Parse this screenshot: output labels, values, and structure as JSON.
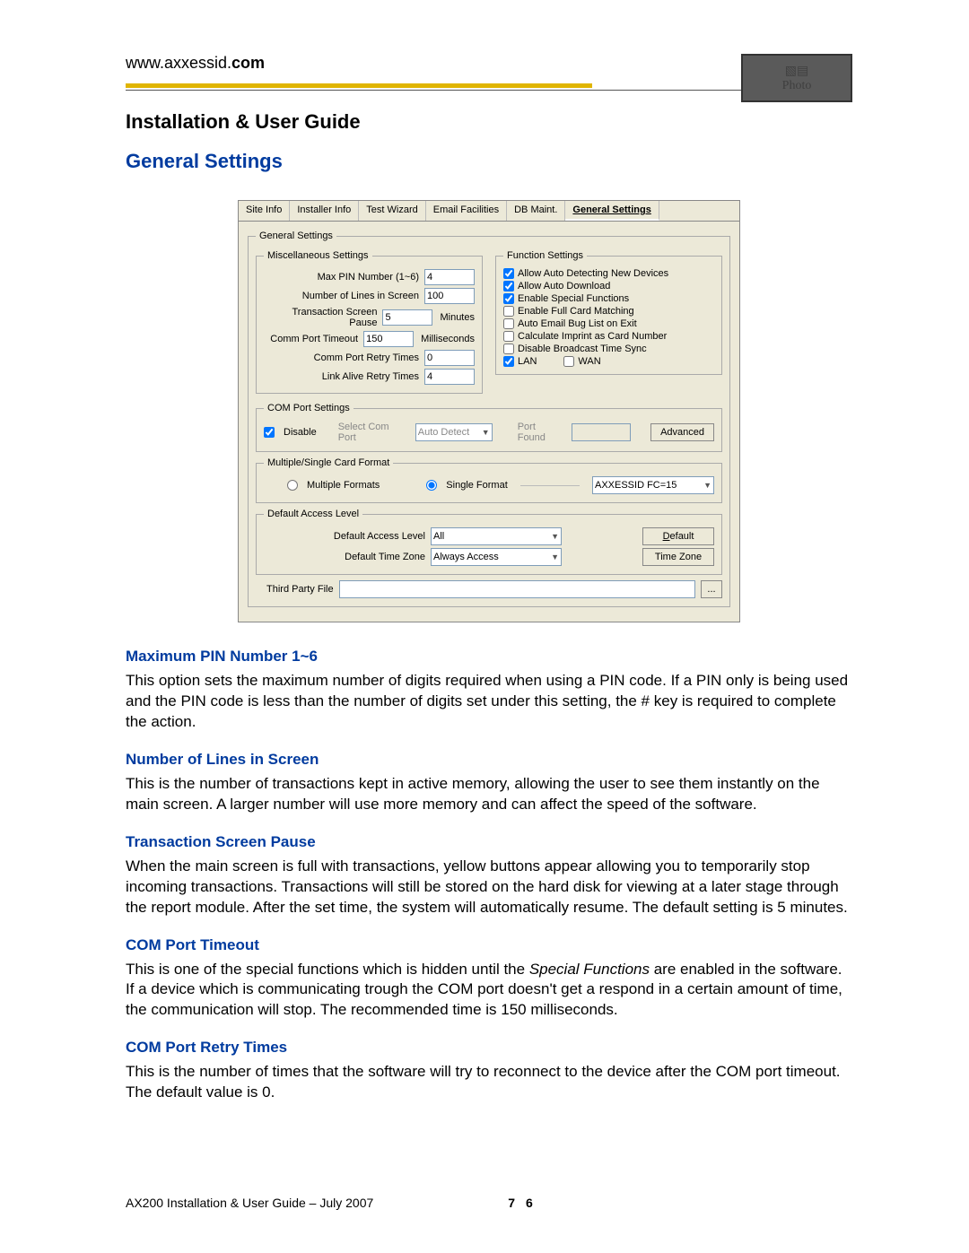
{
  "header": {
    "url_prefix": "www.axxessid.",
    "url_bold": "com",
    "logo_text": "Photo"
  },
  "doc": {
    "title": "Installation & User Guide",
    "section": "General Settings"
  },
  "dialog": {
    "tabs": [
      "Site Info",
      "Installer Info",
      "Test Wizard",
      "Email Facilities",
      "DB Maint.",
      "General Settings"
    ],
    "selected_tab": "General Settings",
    "gs_legend": "General Settings",
    "misc_legend": "Miscellaneous Settings",
    "misc": {
      "max_pin_label": "Max PIN Number (1~6)",
      "max_pin_value": "4",
      "lines_label": "Number of Lines in Screen",
      "lines_value": "100",
      "pause_label": "Transaction Screen Pause",
      "pause_value": "5",
      "pause_unit": "Minutes",
      "timeout_label": "Comm Port Timeout",
      "timeout_value": "150",
      "timeout_unit": "Milliseconds",
      "retry_label": "Comm Port Retry Times",
      "retry_value": "0",
      "alive_label": "Link Alive Retry Times",
      "alive_value": "4"
    },
    "func_legend": "Function Settings",
    "func": {
      "auto_detect": "Allow Auto Detecting New Devices",
      "auto_download": "Allow Auto Download",
      "special": "Enable Special Functions",
      "full_card": "Enable Full Card Matching",
      "auto_email": "Auto Email Bug List on Exit",
      "imprint": "Calculate Imprint as Card Number",
      "broadcast": "Disable Broadcast Time Sync",
      "lan": "LAN",
      "wan": "WAN"
    },
    "com_legend": "COM Port Settings",
    "com": {
      "disable": "Disable",
      "select_label": "Select Com Port",
      "select_value": "Auto Detect",
      "port_found_label": "Port Found",
      "advanced_btn": "Advanced"
    },
    "format_legend": "Multiple/Single Card Format",
    "format": {
      "multiple": "Multiple Formats",
      "single": "Single Format",
      "dropdown": "AXXESSID FC=15"
    },
    "access_legend": "Default Access Level",
    "access": {
      "level_label": "Default Access Level",
      "level_value": "All",
      "default_btn": "Default",
      "tz_label": "Default Time Zone",
      "tz_value": "Always Access",
      "tz_btn": "Time Zone"
    },
    "third_party_label": "Third Party File",
    "ellipsis": "..."
  },
  "sections": [
    {
      "title": "Maximum PIN Number 1~6",
      "body": "This option sets the maximum number of digits required when using a PIN code.  If a PIN only is being used and the PIN code is less than the number of digits set under this setting, the # key is required to complete the action."
    },
    {
      "title": "Number of Lines in Screen",
      "body": "This is the number of transactions kept in active memory, allowing the user to see them instantly on the main screen.  A larger number will use more memory and can affect the speed of the software."
    },
    {
      "title": "Transaction Screen Pause",
      "body": "When the main screen is full with transactions, yellow buttons appear allowing you to temporarily stop incoming transactions.  Transactions will still be stored on the hard disk for viewing at a later stage through the report module.  After the set time, the system will automatically resume.  The default setting is 5 minutes."
    },
    {
      "title": "COM Port Timeout",
      "body_html": "This is one of the special functions which is hidden until the <i>Special Functions</i> are enabled in the software. If a device which is communicating trough the COM port doesn't get a respond in a certain amount of time, the communication will stop. The recommended time is 150 milliseconds."
    },
    {
      "title": "COM Port Retry Times",
      "body": "This is the number of times that the software will try to reconnect to the device after the COM port timeout. The default value is 0."
    }
  ],
  "footer": {
    "left": "AX200 Installation & User Guide – July 2007",
    "page": "7 6"
  }
}
